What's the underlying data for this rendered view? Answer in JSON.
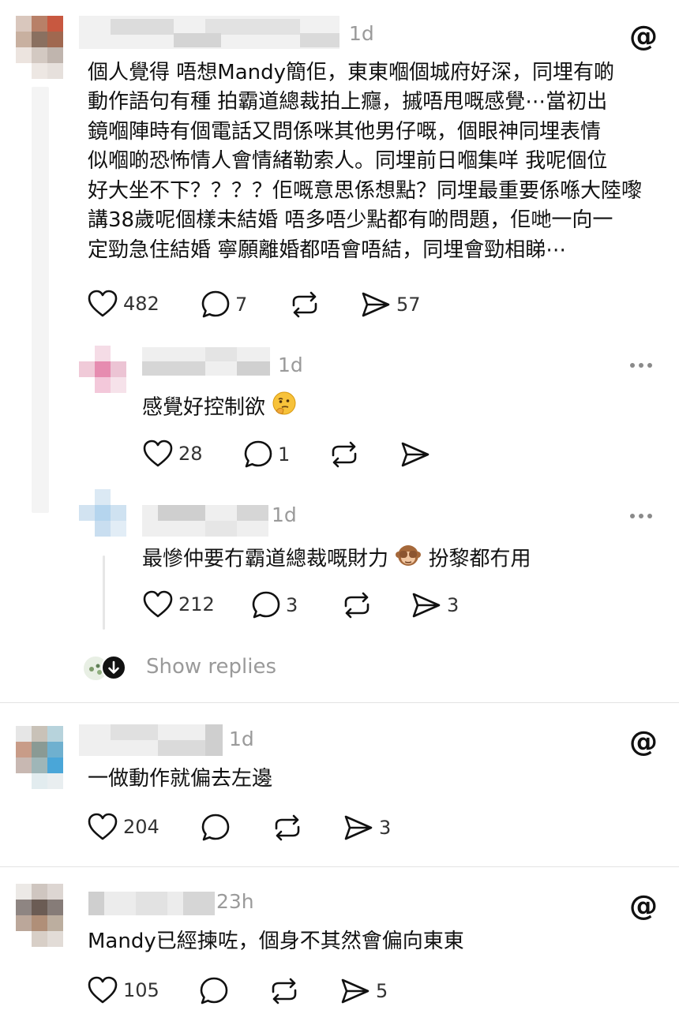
{
  "colors": {
    "text": "#111111",
    "muted": "#9a9a9a",
    "divider": "#e3e3e3"
  },
  "posts": [
    {
      "time": "1d",
      "text_lines": [
        "個人覺得 唔想Mandy簡佢，東東嗰個城府好深，同埋有啲",
        "動作語句有種 拍霸道總裁拍上癮，摵唔甩嘅感覺⋯當初出",
        "鏡嗰陣時有個電話又問係咪其他男仔嘅，個眼神同埋表情",
        "似嗰啲恐怖情人會情緒勒索人。同埋前日嗰集咩 我呢個位",
        "好大坐不下？？？？佢嘅意思係想點？同埋最重要係喺大陸嚟",
        "講38歲呢個樣未結婚 唔多唔少點都有啲問題，佢哋一向一",
        "定勁急住結婚 寧願離婚都唔會唔結，同埋會勁相睇⋯"
      ],
      "likes": "482",
      "replies": "7",
      "shares": "57",
      "icon": "threads-logo-icon"
    },
    {
      "time": "1d",
      "text": "感覺好控制欲",
      "emoji": "thinking-face",
      "likes": "28",
      "replies": "1"
    },
    {
      "time": "1d",
      "text_before": "最慘仲要冇霸道總裁嘅財力",
      "emoji": "see-no-evil-monkey",
      "text_after": "扮黎都冇用",
      "likes": "212",
      "replies": "3",
      "shares": "3"
    },
    {
      "time": "1d",
      "text": "一做動作就偏去左邊",
      "likes": "204",
      "shares": "3",
      "icon": "threads-logo-icon"
    },
    {
      "time": "23h",
      "text": "Mandy已經揀咗，個身不其然會偏向東東",
      "likes": "105",
      "shares": "5",
      "icon": "threads-logo-icon"
    }
  ],
  "show_replies": "Show replies"
}
